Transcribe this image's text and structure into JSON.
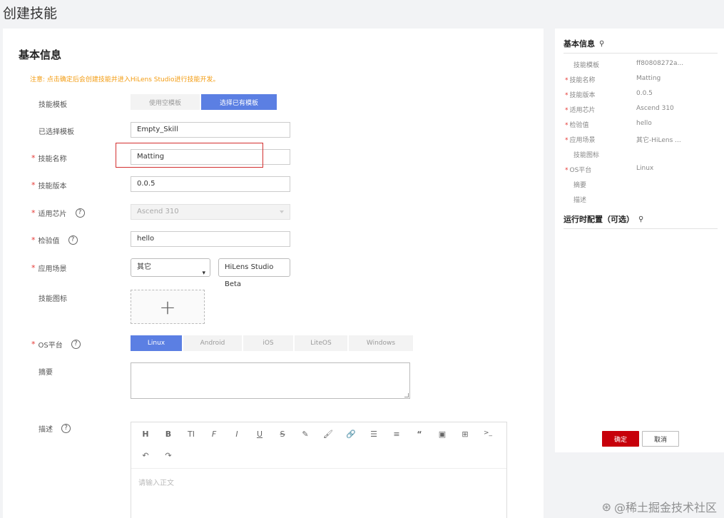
{
  "page": {
    "title": "创建技能"
  },
  "form": {
    "section_title": "基本信息",
    "notice": "注意: 点击确定后会创建技能并进入HiLens Studio进行技能开发。",
    "template_label": "技能模板",
    "template_options": [
      "使用空模板",
      "选择已有模板"
    ],
    "selected_template_label": "已选择模板",
    "selected_template_value": "Empty_Skill",
    "skill_name_label": "技能名称",
    "skill_name_value": "Matting",
    "version_label": "技能版本",
    "version_value": "0.0.5",
    "chip_label": "适用芯片",
    "chip_value": "Ascend 310",
    "checksum_label": "检验值",
    "checksum_value": "hello",
    "scene_label": "应用场景",
    "scene_value": "其它",
    "scene_extra": "HiLens Studio Beta",
    "icon_label": "技能图标",
    "upload_glyph": "+",
    "os_label": "OS平台",
    "os_options": [
      "Linux",
      "Android",
      "iOS",
      "LiteOS",
      "Windows"
    ],
    "summary_label": "摘要",
    "desc_label": "描述",
    "desc_placeholder": "请输入正文",
    "required_mark": "*",
    "help_glyph": "?"
  },
  "editor_toolbar": {
    "row1": [
      "H",
      "B",
      "TI",
      "F",
      "I",
      "U",
      "S",
      "✎",
      "🖌",
      "🔗",
      "☰",
      "≡",
      "“",
      "▣",
      "⊞",
      ">_"
    ],
    "row2": [
      "↶",
      "↷"
    ]
  },
  "sidebar": {
    "title": "基本信息",
    "pin_glyph": "⚲",
    "rows": [
      {
        "key": "技能模板",
        "value": "ff80808272a...",
        "required": false
      },
      {
        "key": "技能名称",
        "value": "Matting",
        "required": true
      },
      {
        "key": "技能版本",
        "value": "0.0.5",
        "required": true
      },
      {
        "key": "适用芯片",
        "value": "Ascend 310",
        "required": true
      },
      {
        "key": "检验值",
        "value": "hello",
        "required": true
      },
      {
        "key": "应用场景",
        "value": "其它-HiLens ...",
        "required": true
      },
      {
        "key": "技能图标",
        "value": "",
        "required": false
      },
      {
        "key": "OS平台",
        "value": "Linux",
        "required": true
      },
      {
        "key": "摘要",
        "value": "",
        "required": false
      },
      {
        "key": "描述",
        "value": "",
        "required": false
      }
    ],
    "runtime_title": "运行时配置（可选）",
    "confirm_label": "确定",
    "cancel_label": "取消"
  },
  "watermark": {
    "text": "@稀土掘金技术社区",
    "logo": "⊛"
  },
  "colors": {
    "accent": "#5b7fe3",
    "primary_button": "#c7000b",
    "required": "#e53935",
    "notice": "#f39c12",
    "highlight": "#d32f2f"
  }
}
